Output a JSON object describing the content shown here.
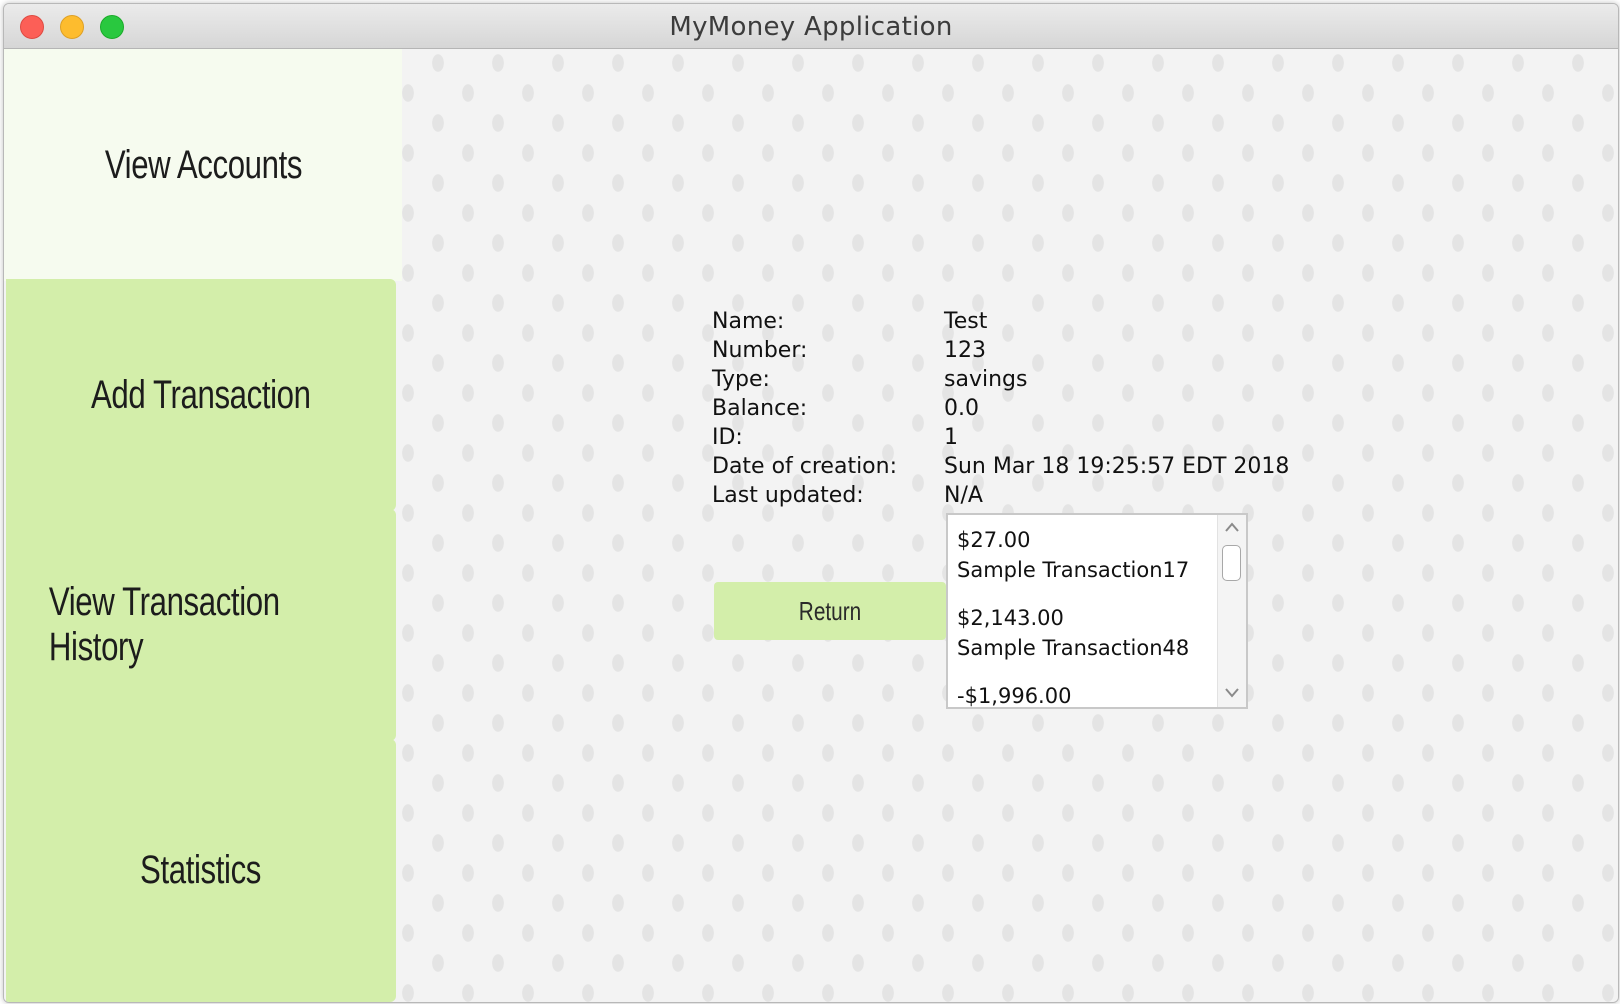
{
  "window": {
    "title": "MyMoney Application"
  },
  "sidebar": {
    "items": [
      {
        "label": "View Accounts",
        "active": true
      },
      {
        "label": "Add Transaction",
        "active": false
      },
      {
        "label": "View Transaction History",
        "active": false
      },
      {
        "label": "Statistics",
        "active": false
      }
    ]
  },
  "account": {
    "rows": [
      {
        "label": "Name:",
        "value": "Test"
      },
      {
        "label": "Number:",
        "value": "123"
      },
      {
        "label": "Type:",
        "value": "savings"
      },
      {
        "label": "Balance:",
        "value": "0.0"
      },
      {
        "label": "ID:",
        "value": "1"
      },
      {
        "label": "Date of creation:",
        "value": "Sun Mar 18 19:25:57 EDT 2018"
      },
      {
        "label": "Last updated:",
        "value": "N/A"
      }
    ]
  },
  "return_button": {
    "label": "Return"
  },
  "transactions": [
    {
      "amount": "$27.00",
      "name": "Sample Transaction17"
    },
    {
      "amount": "$2,143.00",
      "name": "Sample Transaction48"
    },
    {
      "amount": "-$1,996.00",
      "name": ""
    }
  ],
  "icons": {
    "scroll_up": "chevron-up-icon",
    "scroll_down": "chevron-down-icon"
  },
  "colors": {
    "sidebar_button": "#d3eeaa",
    "sidebar_active": "#f6fbef",
    "close": "#fc5f57",
    "minimize": "#fdbc2e",
    "maximize": "#29c83f"
  }
}
